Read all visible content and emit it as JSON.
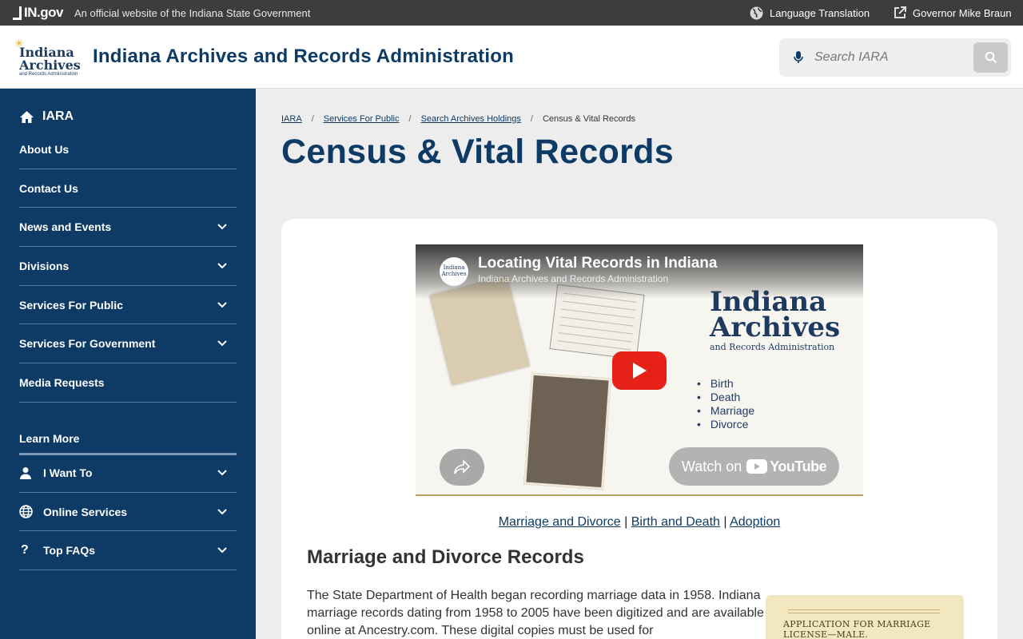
{
  "topbar": {
    "logo": "IN.gov",
    "official": "An official website of the Indiana State Government",
    "language": "Language Translation",
    "governor": "Governor Mike Braun"
  },
  "header": {
    "logo_line1": "Indiana",
    "logo_line2": "Archives",
    "logo_line3": "and Records Administration",
    "title": "Indiana Archives and Records Administration",
    "search_placeholder": "Search IARA"
  },
  "sidebar": {
    "home_label": "IARA",
    "items": [
      {
        "label": "About Us"
      },
      {
        "label": "Contact Us"
      },
      {
        "label": "News and Events"
      },
      {
        "label": "Divisions"
      },
      {
        "label": "Services For Public"
      },
      {
        "label": "Services For Government"
      },
      {
        "label": "Media Requests"
      }
    ],
    "learn_more": "Learn More",
    "learn_items": [
      {
        "label": "I Want To",
        "icon": "person-icon"
      },
      {
        "label": "Online Services",
        "icon": "globe-icon"
      },
      {
        "label": "Top FAQs",
        "icon": "question-icon"
      }
    ]
  },
  "breadcrumb": [
    "IARA",
    "Services For Public",
    "Search Archives Holdings",
    "Census & Vital Records"
  ],
  "page_title": "Census & Vital Records",
  "video": {
    "title": "Locating Vital Records in Indiana",
    "channel": "Indiana Archives and Records Administration",
    "channel_logo": "Indiana Archives",
    "logo_line1": "Indiana",
    "logo_line2": "Archives",
    "logo_line3": "and Records Administration",
    "bullets": [
      "Birth",
      "Death",
      "Marriage",
      "Divorce"
    ],
    "watch_on": "Watch on",
    "youtube": "YouTube"
  },
  "links": {
    "marriage": "Marriage and Divorce",
    "birth": "Birth and Death",
    "adoption": "Adoption",
    "separator": "|"
  },
  "section": {
    "title": "Marriage and Divorce Records",
    "paragraph": "The State Department of Health began recording marriage data in 1958. Indiana marriage records dating from 1958 to 2005 have been digitized and are available online at Ancestry.com. These digital copies must be used for",
    "image_caption": "APPLICATION FOR MARRIAGE LICENSE—MALE."
  }
}
